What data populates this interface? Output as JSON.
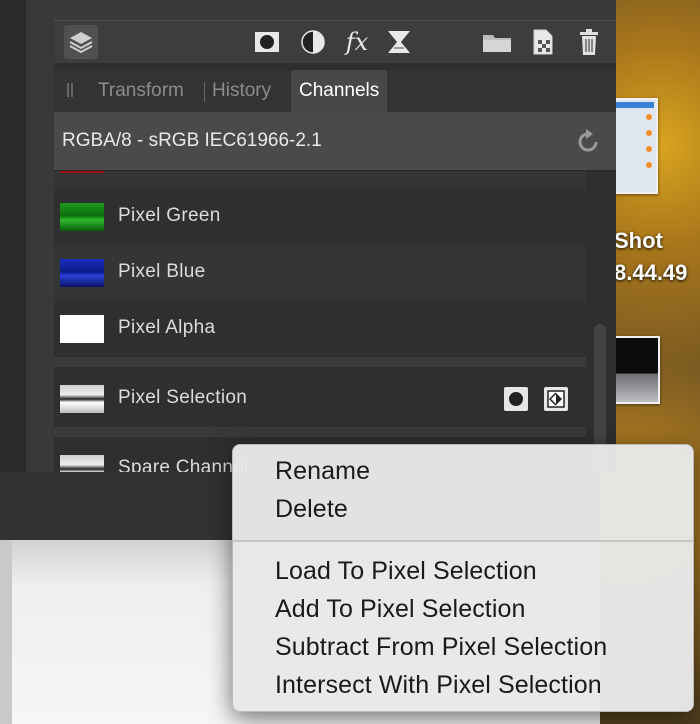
{
  "desktop": {
    "label_line1": "Shot",
    "label_line2": "8.44.49"
  },
  "toolbar": {
    "layers_icon": "layers-icon",
    "buttons": [
      "mask-icon",
      "adjustment-icon",
      "fx-icon",
      "live-filter-icon",
      "group-folder-icon",
      "add-pixel-layer-icon",
      "trash-icon"
    ],
    "fx_label": "fx"
  },
  "tabs": [
    {
      "label": "Transform"
    },
    {
      "label": "History"
    },
    {
      "label": "Channels",
      "active": true
    }
  ],
  "format": {
    "text": "RGBA/8 - sRGB IEC61966-2.1"
  },
  "channels": [
    {
      "label": "Pixel Green",
      "thumb": "#0c8a0c"
    },
    {
      "label": "Pixel Blue",
      "thumb": "#0c1ea6"
    },
    {
      "label": "Pixel Alpha",
      "thumb": "#ffffff"
    },
    {
      "label": "Pixel Selection"
    },
    {
      "label": "Spare Channel"
    }
  ],
  "context_menu": {
    "items": [
      "Rename",
      "Delete",
      "Load To Pixel Selection",
      "Add To Pixel Selection",
      "Subtract From Pixel Selection",
      "Intersect With Pixel Selection"
    ]
  },
  "colors": {
    "panel_bg": "#2f2f2f",
    "menu_bg": "#e8e8e8",
    "active_tab_text": "#ffffff"
  }
}
